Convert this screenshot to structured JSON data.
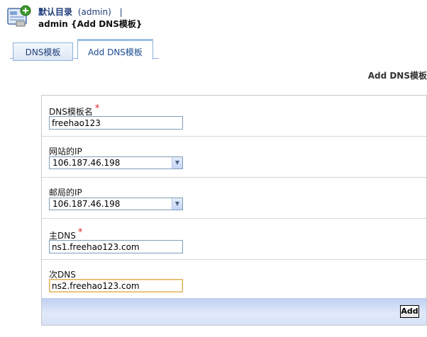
{
  "header": {
    "root_label": "默认目录",
    "user_label": "(admin)",
    "separator": "|",
    "subtitle": "admin {Add DNS模板}"
  },
  "tabs": [
    {
      "label": "DNS模板",
      "active": false
    },
    {
      "label": "Add DNS模板",
      "active": true
    }
  ],
  "section_heading": "Add DNS模板",
  "form": {
    "template_name": {
      "label": "DNS模板名",
      "required_mark": "*",
      "value": "freehao123"
    },
    "site_ip": {
      "label": "网站的IP",
      "selected": "106.187.46.198"
    },
    "mail_ip": {
      "label": "邮局的IP",
      "selected": "106.187.46.198"
    },
    "primary_dns": {
      "label": "主DNS",
      "required_mark": "*",
      "value": "ns1.freehao123.com"
    },
    "secondary_dns": {
      "label": "次DNS",
      "value": "ns2.freehao123.com"
    },
    "submit_label": "Add"
  },
  "colors": {
    "tab_border": "#8fb1d8",
    "required": "#e02020",
    "footer_bar": "#d7e1f7"
  }
}
